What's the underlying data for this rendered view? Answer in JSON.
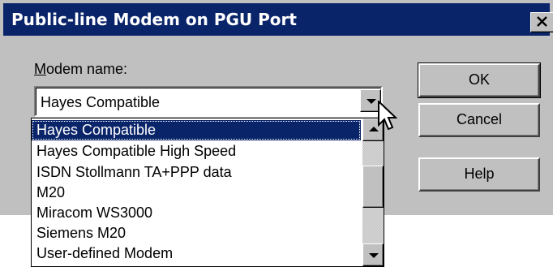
{
  "dialog": {
    "title": "Public-line Modem on PGU Port",
    "close_icon": "close-x-icon"
  },
  "modem_name": {
    "label_accel": "M",
    "label_rest": "odem name:",
    "selected_value": "Hayes Compatible",
    "dropdown_icon": "chevron-down-icon",
    "options": [
      "Hayes Compatible",
      "Hayes Compatible High Speed",
      "ISDN Stollmann TA+PPP data",
      "M20",
      "Miracom WS3000",
      "Siemens M20",
      "User-defined Modem"
    ],
    "highlighted_option": "Hayes Compatible"
  },
  "buttons": {
    "ok": "OK",
    "cancel": "Cancel",
    "help": "Help"
  },
  "scrollbar": {
    "up_icon": "scroll-up-arrow-icon",
    "down_icon": "scroll-down-arrow-icon"
  },
  "cursor": {
    "icon": "mouse-pointer-icon"
  },
  "colors": {
    "titlebar": "#0a246a",
    "face": "#c0c0c0",
    "highlight": "#0a246a"
  }
}
